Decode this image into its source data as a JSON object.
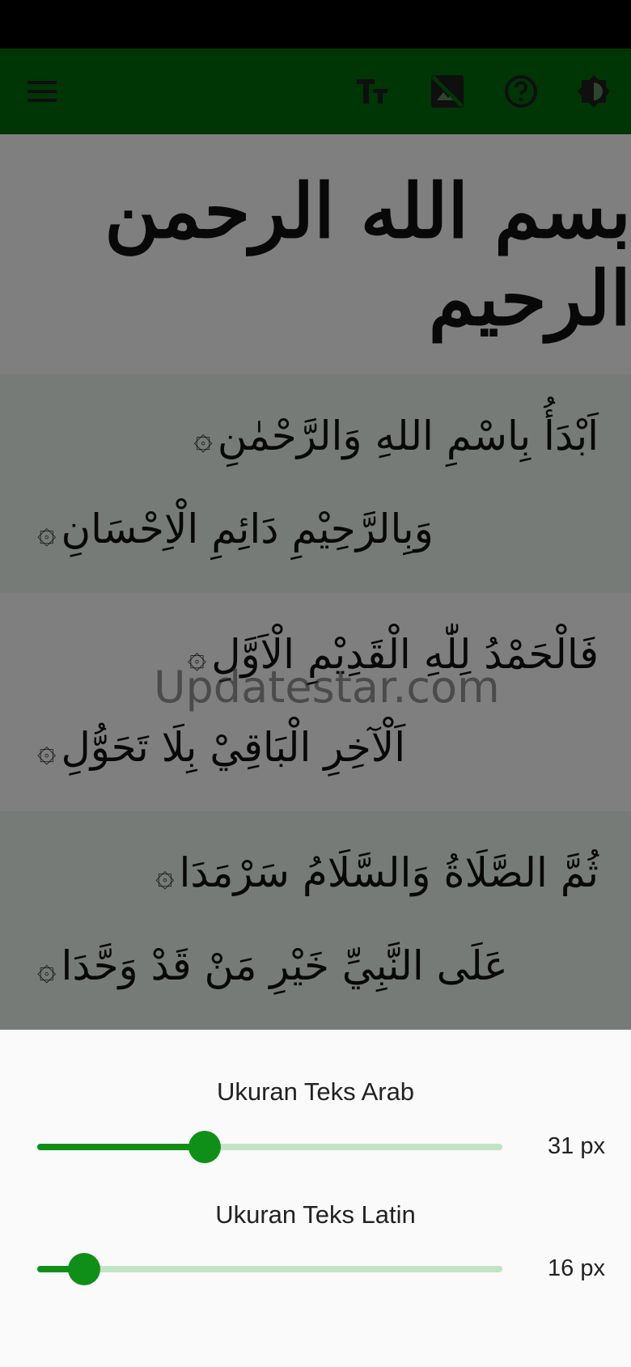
{
  "appbar": {
    "background": "#006b0c",
    "icons": [
      "menu-icon",
      "text-size-icon",
      "image-off-icon",
      "help-icon",
      "brightness-icon"
    ]
  },
  "bismillah": "بسم الله الرحمن الرحيم",
  "stanzas": [
    {
      "line1": "اَبْدَأُ بِاسْمِ اللهِ وَالرَّحْمٰنِ",
      "line2": "وَبِالرَّحِيْمِ دَائِمِ الْاِحْسَانِ"
    },
    {
      "line1": "فَالْحَمْدُ لِلّٰهِ الْقَدِيْمِ الْاَوَّلِ",
      "line2": "اَلْآخِرِ الْبَاقِيْ بِلَا تَحَوُّلِ"
    },
    {
      "line1": "ثُمَّ الصَّلَاةُ وَالسَّلَامُ سَرْمَدَا",
      "line2": "عَلَى النَّبِيِّ خَيْرِ مَنْ قَدْ وَحَّدَا"
    }
  ],
  "watermark": "Updatestar.com",
  "sheet": {
    "arab": {
      "title": "Ukuran Teks Arab",
      "value": "31 px",
      "level": 0.36
    },
    "latin": {
      "title": "Ukuran Teks Latin",
      "value": "16 px",
      "level": 0.1
    }
  },
  "colors": {
    "accent": "#108f18",
    "track": "#c3e3c5",
    "appbar": "#006b0c"
  }
}
